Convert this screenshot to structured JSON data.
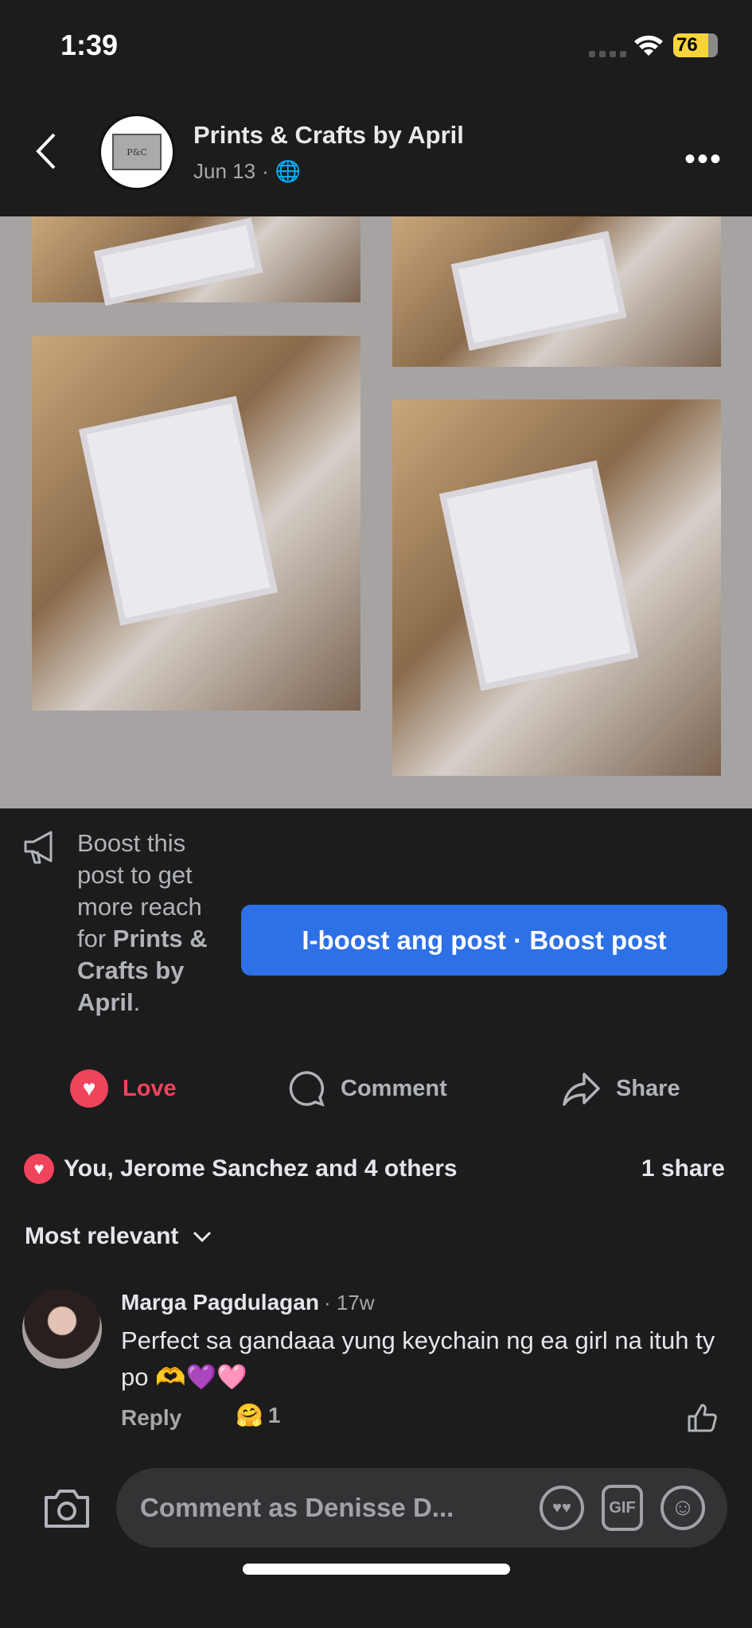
{
  "status_bar": {
    "time": "1:39",
    "battery": "76"
  },
  "header": {
    "page_name": "Prints & Crafts by April",
    "date": "Jun 13",
    "separator": "·",
    "avatar_logo_text": "Prints & Crafts"
  },
  "boost": {
    "text_prefix": "Boost this post to get more reach for ",
    "page_name": "Prints & Crafts by April",
    "text_suffix": ".",
    "button_label": "I-boost ang post · Boost post"
  },
  "actions": {
    "love": "Love",
    "comment": "Comment",
    "share": "Share"
  },
  "reactions": {
    "summary": "You, Jerome Sanchez and 4 others",
    "shares": "1 share"
  },
  "sort": {
    "label": "Most relevant"
  },
  "comment": {
    "author": "Marga Pagdulagan",
    "time": "· 17w",
    "text": "Perfect sa gandaaa yung keychain ng ea girl na ituh ty po 🫶💜🩷",
    "reply": "Reply",
    "reaction_emoji": "🤗",
    "reaction_count": "1"
  },
  "composer": {
    "placeholder": "Comment as Denisse D...",
    "gif": "GIF"
  },
  "colors": {
    "accent": "#2e70e5",
    "love": "#f0435c",
    "background": "#1c1c1d"
  }
}
